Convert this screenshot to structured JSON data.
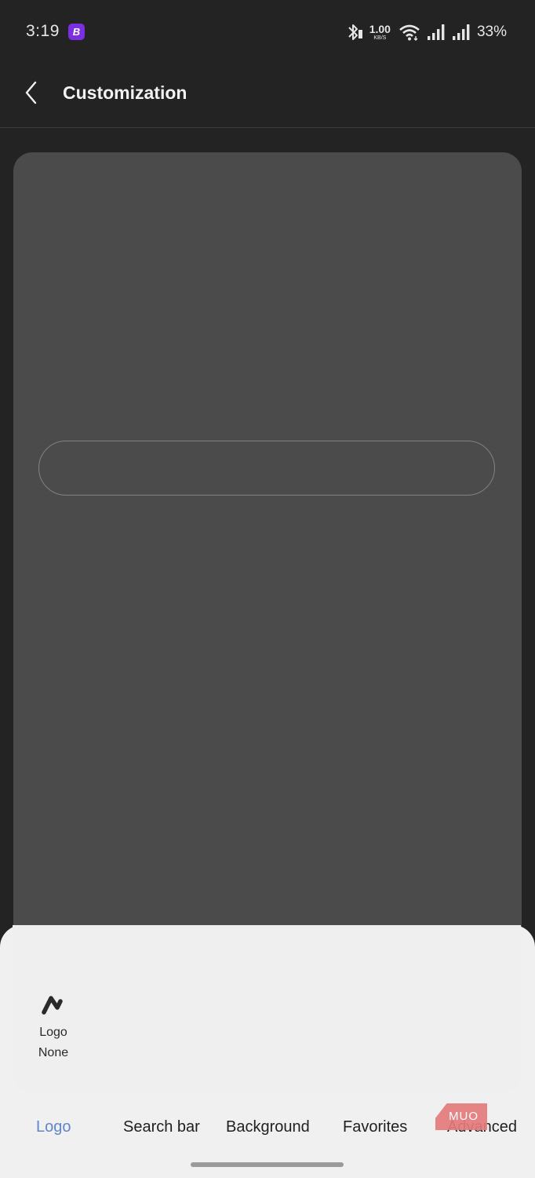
{
  "status_bar": {
    "time": "3:19",
    "app_icon_letter": "B",
    "app_icon_color": "#7c2fe0",
    "net_speed_value": "1.00",
    "net_speed_unit": "KB/S",
    "battery": "33%",
    "icons": [
      "bluetooth-icon",
      "wifi-icon",
      "signal-icon",
      "signal-icon"
    ]
  },
  "header": {
    "title": "Customization",
    "back_icon": "chevron-left-icon"
  },
  "preview": {
    "background_color": "#4b4b4b"
  },
  "logo_option": {
    "icon": "logo-mark-icon",
    "label": "Logo",
    "value": "None"
  },
  "tabs": [
    {
      "label": "Logo",
      "active": true
    },
    {
      "label": "Search bar",
      "active": false
    },
    {
      "label": "Background",
      "active": false
    },
    {
      "label": "Favorites",
      "active": false
    },
    {
      "label": "Advanced",
      "active": false
    }
  ],
  "watermark": "MUO",
  "colors": {
    "active_tab": "#5f86c9",
    "background": "#232323",
    "sheet": "#f0f0f0"
  }
}
